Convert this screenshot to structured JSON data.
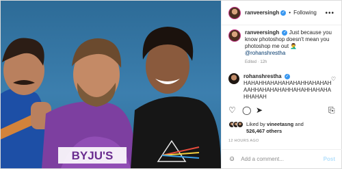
{
  "post": {
    "username": "ranveersingh",
    "follow_state": "Following",
    "caption": {
      "text": "Just because you know photoshop doesn't mean you photoshop me out 🤦‍♂️ ",
      "mention": "@rohanshrestha",
      "edited": "Edited · 12h"
    },
    "comment": {
      "username": "rohanshrestha",
      "text": "HAHAHHAHAHAHAHAHHAHAHAHAAHHAHAHAHAHHAHAHHAHAHAHHAHAH"
    },
    "likes": {
      "prefix": "Liked by ",
      "user": "vineetasng",
      "and": " and",
      "count": "526,467 others"
    },
    "time_ago": "12 HOURS AGO",
    "add_comment_placeholder": "Add a comment...",
    "post_button": "Post"
  },
  "photo": {
    "shirt_text": "BYJU'S"
  },
  "colors": {
    "link": "#00376b",
    "verified": "#3897f0",
    "post_disabled": "#b2dffc",
    "story_ring": "#c13584"
  },
  "icons": [
    "verified-icon",
    "more-options-icon",
    "heart-icon",
    "comment-icon",
    "share-icon",
    "save-icon",
    "emoji-icon"
  ]
}
